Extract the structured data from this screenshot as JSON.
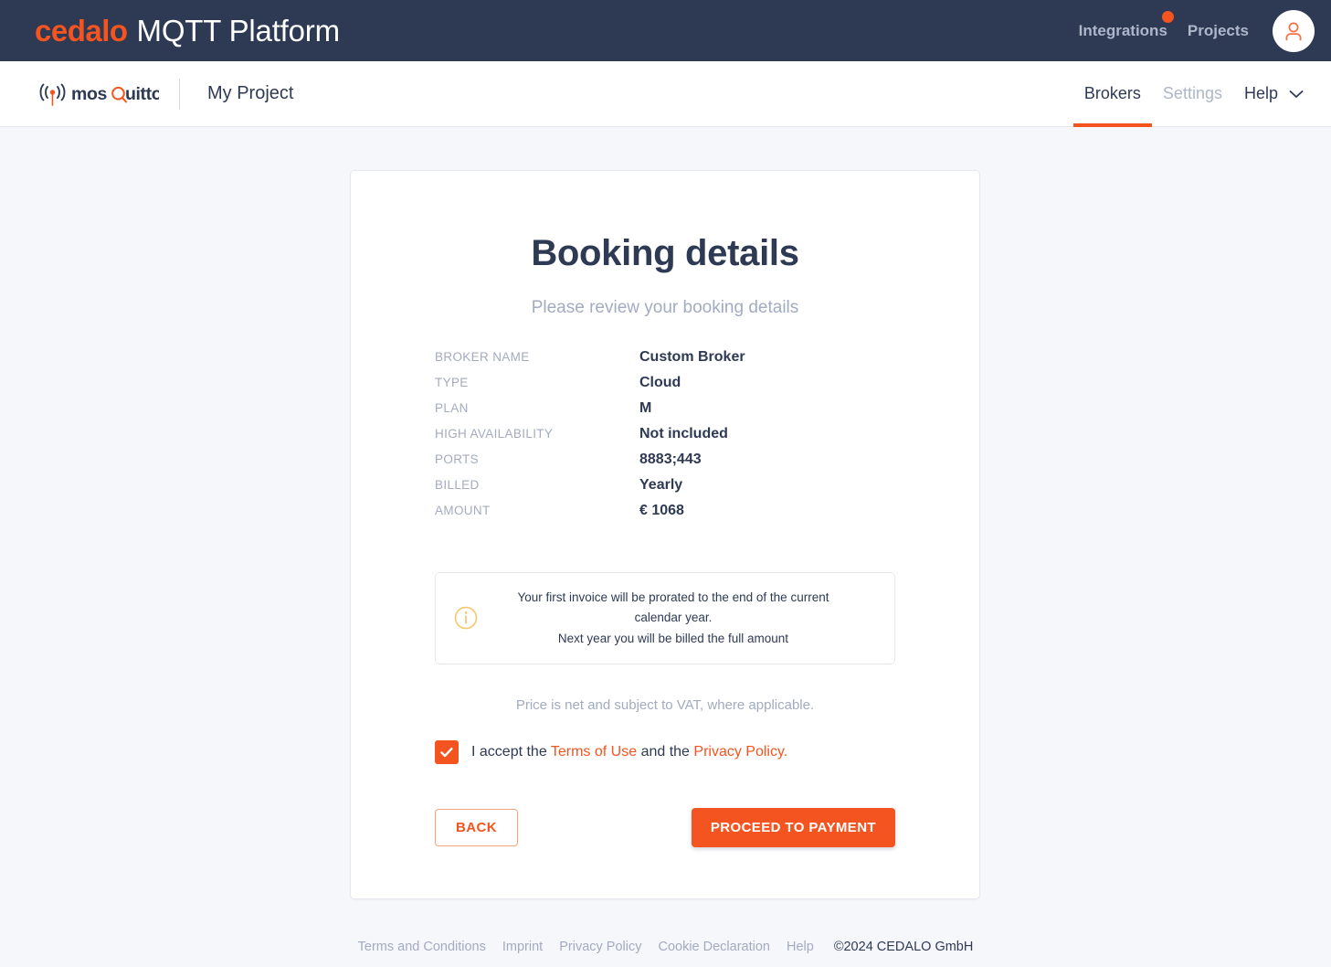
{
  "colors": {
    "brand_orange": "#f4541f",
    "navy": "#2e3a54",
    "muted": "#a3abc0",
    "page_bg": "#f6f7fb",
    "info_amber": "#f5c66b"
  },
  "topbar": {
    "brand_name": "cedalo",
    "brand_product": "MQTT Platform",
    "links": [
      {
        "label": "Integrations",
        "has_badge": true
      },
      {
        "label": "Projects",
        "has_badge": false
      }
    ],
    "avatar_icon": "user-avatar-icon"
  },
  "subnav": {
    "logo_text": "mosquitto",
    "project": "My Project",
    "tabs": [
      {
        "label": "Brokers",
        "active": true,
        "muted": false,
        "caret": false
      },
      {
        "label": "Settings",
        "active": false,
        "muted": true,
        "caret": false
      },
      {
        "label": "Help",
        "active": false,
        "muted": false,
        "caret": true
      }
    ]
  },
  "card": {
    "title": "Booking details",
    "subtitle": "Please review your booking details",
    "details": [
      {
        "label": "BROKER NAME",
        "value": "Custom Broker"
      },
      {
        "label": "TYPE",
        "value": "Cloud"
      },
      {
        "label": "PLAN",
        "value": "M"
      },
      {
        "label": "HIGH AVAILABILITY",
        "value": "Not included"
      },
      {
        "label": "PORTS",
        "value": "8883;443"
      },
      {
        "label": "BILLED",
        "value": "Yearly"
      },
      {
        "label": "AMOUNT",
        "value": "€ 1068"
      }
    ],
    "info": {
      "icon": "info-circle-icon",
      "line1": "Your first invoice will be prorated to the end of the current calendar year.",
      "line2": "Next year you will be billed the full amount"
    },
    "vat_note": "Price is net and subject to VAT, where applicable.",
    "accept": {
      "checked": true,
      "prefix": "I accept the ",
      "terms_link": "Terms of Use",
      "middle": " and the ",
      "privacy_link": "Privacy Policy."
    },
    "buttons": {
      "back": "BACK",
      "proceed": "PROCEED TO PAYMENT"
    }
  },
  "footer": {
    "links": [
      "Terms and Conditions",
      "Imprint",
      "Privacy Policy",
      "Cookie Declaration",
      "Help"
    ],
    "copyright": "©2024 CEDALO GmbH"
  }
}
